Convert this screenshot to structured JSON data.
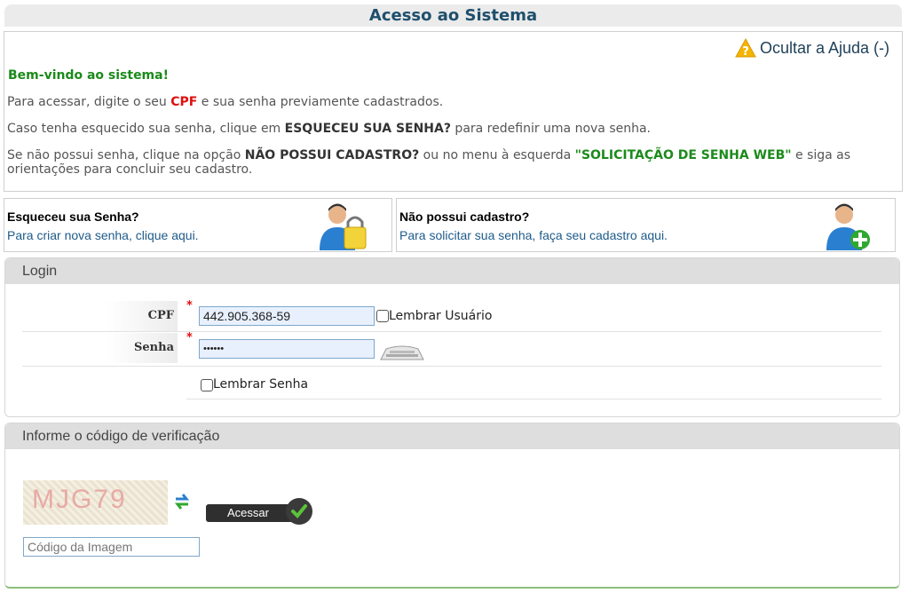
{
  "header": {
    "title": "Acesso ao Sistema"
  },
  "help": {
    "toggle_label": "Ocultar a Ajuda (-)",
    "welcome": "Bem-vindo ao sistema!",
    "p1_a": "Para acessar, digite o seu ",
    "p1_cpf": "CPF",
    "p1_b": " e sua senha previamente cadastrados.",
    "p2_a": "Caso tenha esquecido sua senha, clique em ",
    "p2_bold": "ESQUECEU SUA SENHA?",
    "p2_b": " para redefinir uma nova senha.",
    "p3_a": "Se não possui senha, clique na opção ",
    "p3_bold": "NÃO POSSUI CADASTRO?",
    "p3_b": " ou no menu à esquerda ",
    "p3_green": "\"SOLICITAÇÃO DE SENHA WEB\"",
    "p3_c": " e siga as orientações para concluir seu cadastro."
  },
  "cards": {
    "forgot": {
      "title": "Esqueceu sua Senha?",
      "subtitle": "Para criar nova senha, clique aqui.",
      "icon": "user-lock-icon"
    },
    "register": {
      "title": "Não possui cadastro?",
      "subtitle": "Para solicitar sua senha, faça seu cadastro aqui.",
      "icon": "user-add-icon"
    }
  },
  "login": {
    "header": "Login",
    "cpf_label": "CPF",
    "cpf_value": "442.905.368-59",
    "remember_user": "Lembrar Usuário",
    "password_label": "Senha",
    "password_value": "••••••",
    "remember_password": "Lembrar Senha",
    "required_mark": "*"
  },
  "verification": {
    "header": "Informe o código de verificação",
    "captcha_text": "MJG79",
    "submit_label": "Acessar",
    "code_placeholder": "Código da Imagem"
  },
  "colors": {
    "title": "#1f4f6c",
    "accent_green": "#1b8a1b",
    "required": "#e01010"
  }
}
